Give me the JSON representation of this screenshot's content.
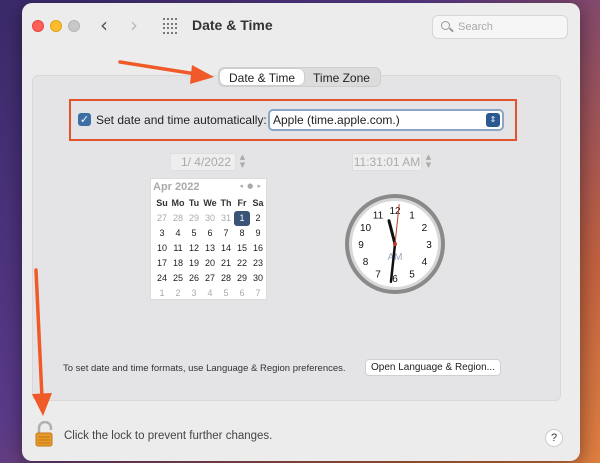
{
  "window": {
    "title": "Date & Time",
    "search_placeholder": "Search"
  },
  "nav": {
    "back": "‹",
    "forward": "›"
  },
  "tabs": [
    {
      "label": "Date & Time",
      "active": true
    },
    {
      "label": "Time Zone",
      "active": false
    }
  ],
  "auto_time": {
    "checked": true,
    "check_glyph": "✓",
    "label": "Set date and time automatically:",
    "server": "Apple (time.apple.com.)"
  },
  "date_field": {
    "value": "1/  4/2022"
  },
  "time_field": {
    "value": "11:31:01 AM"
  },
  "calendar": {
    "month_label": "Apr 2022",
    "nav_glyphs": "◂ ● ▸",
    "weekdays": [
      "Su",
      "Mo",
      "Tu",
      "We",
      "Th",
      "Fr",
      "Sa"
    ],
    "weeks": [
      [
        {
          "d": "27",
          "o": true
        },
        {
          "d": "28",
          "o": true
        },
        {
          "d": "29",
          "o": true
        },
        {
          "d": "30",
          "o": true
        },
        {
          "d": "31",
          "o": true
        },
        {
          "d": "1",
          "s": true
        },
        {
          "d": "2"
        }
      ],
      [
        {
          "d": "3"
        },
        {
          "d": "4"
        },
        {
          "d": "5"
        },
        {
          "d": "6"
        },
        {
          "d": "7"
        },
        {
          "d": "8"
        },
        {
          "d": "9"
        }
      ],
      [
        {
          "d": "10"
        },
        {
          "d": "11"
        },
        {
          "d": "12"
        },
        {
          "d": "13"
        },
        {
          "d": "14"
        },
        {
          "d": "15"
        },
        {
          "d": "16"
        }
      ],
      [
        {
          "d": "17"
        },
        {
          "d": "18"
        },
        {
          "d": "19"
        },
        {
          "d": "20"
        },
        {
          "d": "21"
        },
        {
          "d": "22"
        },
        {
          "d": "23"
        }
      ],
      [
        {
          "d": "24"
        },
        {
          "d": "25"
        },
        {
          "d": "26"
        },
        {
          "d": "27"
        },
        {
          "d": "28"
        },
        {
          "d": "29"
        },
        {
          "d": "30"
        }
      ],
      [
        {
          "d": "1",
          "o": true
        },
        {
          "d": "2",
          "o": true
        },
        {
          "d": "3",
          "o": true
        },
        {
          "d": "4",
          "o": true
        },
        {
          "d": "5",
          "o": true
        },
        {
          "d": "6",
          "o": true
        },
        {
          "d": "7",
          "o": true
        }
      ]
    ]
  },
  "clock": {
    "numerals": [
      "12",
      "1",
      "2",
      "3",
      "4",
      "5",
      "6",
      "7",
      "8",
      "9",
      "10",
      "11"
    ],
    "ampm": "AM",
    "hour": 11,
    "minute": 31,
    "second": 1
  },
  "formats": {
    "text": "To set date and time formats, use Language & Region preferences.",
    "button": "Open Language & Region..."
  },
  "lock": {
    "text": "Click the lock to prevent further changes."
  },
  "help": {
    "label": "?"
  },
  "colors": {
    "highlight_border": "#e5532c",
    "arrow": "#f05a28",
    "selected_day": "#3a5478"
  }
}
